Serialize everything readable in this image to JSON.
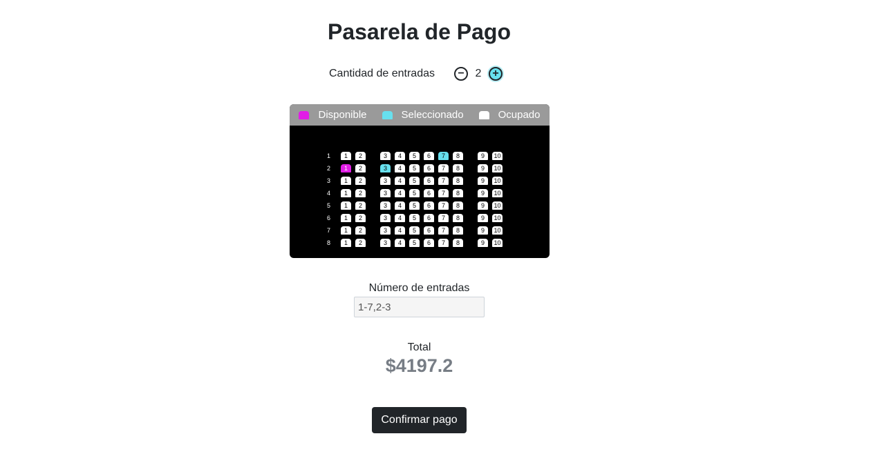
{
  "header": {
    "title": "Pasarela de Pago"
  },
  "quantity": {
    "label": "Cantidad de entradas",
    "value": "2",
    "minus_icon": "minus-circle-icon",
    "plus_icon": "plus-circle-icon"
  },
  "legend": {
    "available": "Disponible",
    "selected": "Seleccionado",
    "occupied": "Ocupado"
  },
  "colors": {
    "available": "#e11ee6",
    "selected": "#67e0ee",
    "occupied": "#ffffff",
    "hall_background": "#000000",
    "legend_bar": "#9a9a9a",
    "button": "#212529"
  },
  "seat_map": {
    "rows": [
      "1",
      "2",
      "3",
      "4",
      "5",
      "6",
      "7",
      "8"
    ],
    "seats": [
      "1",
      "2",
      "3",
      "4",
      "5",
      "6",
      "7",
      "8",
      "9",
      "10"
    ],
    "selected": [
      [
        "1",
        "7"
      ],
      [
        "2",
        "3"
      ]
    ],
    "available": [
      [
        "2",
        "1"
      ]
    ]
  },
  "entries": {
    "label": "Número de entradas",
    "value": "1-7,2-3"
  },
  "total": {
    "label": "Total",
    "value": "$4197.2"
  },
  "actions": {
    "confirm_label": "Confirmar pago"
  }
}
